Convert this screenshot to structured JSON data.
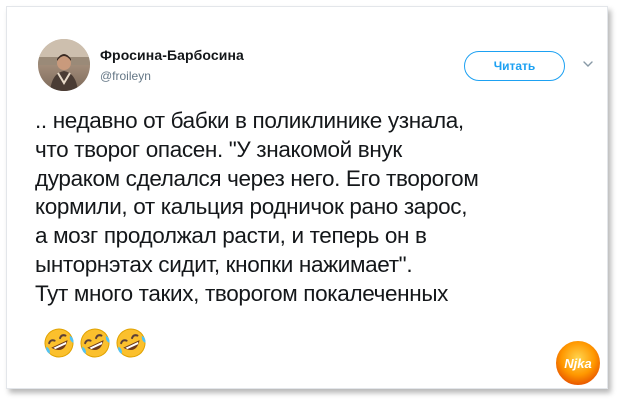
{
  "author": {
    "name": "Фросина-Барбосина",
    "handle": "@froileyn"
  },
  "follow_button": {
    "label": "Читать"
  },
  "tweet": {
    "lines": [
      ".. недавно от бабки в поликлинике узнала,",
      "что творог опасен. \"У знакомой внук",
      "дураком сделался через него. Его творогом",
      "кормили, от кальция родничок рано зарос,",
      "а мозг продолжал расти, и теперь он в",
      "ынторнэтах сидит, кнопки нажимает\".",
      "Тут много таких, творогом покалеченных"
    ],
    "emoji_count": 3,
    "emoji_name": "rolling-on-the-floor-laughing"
  },
  "watermark": {
    "text": "Njka"
  },
  "colors": {
    "accent": "#1da1f2",
    "text": "#14171a",
    "muted": "#657786"
  }
}
